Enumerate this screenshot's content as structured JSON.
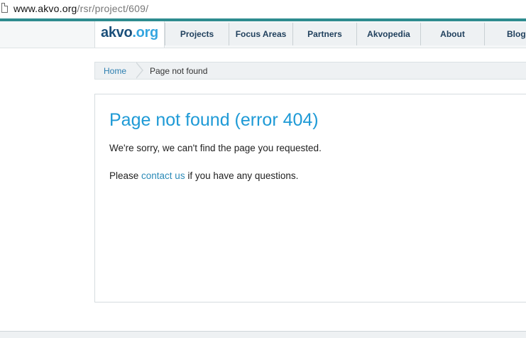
{
  "browser": {
    "url_host": "www.akvo.org",
    "url_path": "/rsr/project/609/"
  },
  "header": {
    "logo": {
      "part1": "akvo",
      "part2": ".org"
    },
    "nav_items": [
      {
        "label": "Projects"
      },
      {
        "label": "Focus Areas"
      },
      {
        "label": "Partners"
      },
      {
        "label": "Akvopedia"
      },
      {
        "label": "About"
      },
      {
        "label": "Blog"
      }
    ]
  },
  "breadcrumb": {
    "home": "Home",
    "current": "Page not found"
  },
  "main": {
    "title": "Page not found (error 404)",
    "message": "We're sorry, we can't find the page you requested.",
    "contact_prefix": "Please ",
    "contact_link": "contact us",
    "contact_suffix": " if you have any questions."
  },
  "colors": {
    "accent_teal": "#2e8c8f",
    "title_blue": "#1e9ad6",
    "link_blue": "#2c8bb8",
    "logo_dark": "#1a4f7a",
    "logo_light": "#35a6e0"
  }
}
